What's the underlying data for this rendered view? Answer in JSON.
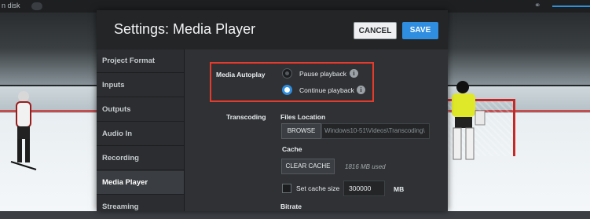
{
  "topbar": {
    "disk_label": "n disk"
  },
  "dialog": {
    "title": "Settings: Media Player",
    "cancel_label": "CANCEL",
    "save_label": "SAVE"
  },
  "sidebar": {
    "items": [
      {
        "label": "Project Format"
      },
      {
        "label": "Inputs"
      },
      {
        "label": "Outputs"
      },
      {
        "label": "Audio In"
      },
      {
        "label": "Recording"
      },
      {
        "label": "Media Player",
        "active": true
      },
      {
        "label": "Streaming"
      }
    ]
  },
  "media_autoplay": {
    "label": "Media Autoplay",
    "options": [
      {
        "label": "Pause playback",
        "selected": false
      },
      {
        "label": "Continue playback",
        "selected": true
      }
    ]
  },
  "transcoding": {
    "label": "Transcoding",
    "files_location_label": "Files Location",
    "browse_label": "BROWSE",
    "path_value": "Windows10-51\\Videos\\Transcoding\\",
    "cache_label": "Cache",
    "clear_cache_label": "CLEAR CACHE",
    "cache_used": "1816 MB used",
    "set_cache_size_label": "Set cache size",
    "cache_size_value": "300000",
    "cache_unit": "MB",
    "bitrate_label": "Bitrate"
  },
  "colors": {
    "accent": "#2f8ee0",
    "highlight_box": "#e53b2c",
    "dialog_bg": "#232527"
  }
}
